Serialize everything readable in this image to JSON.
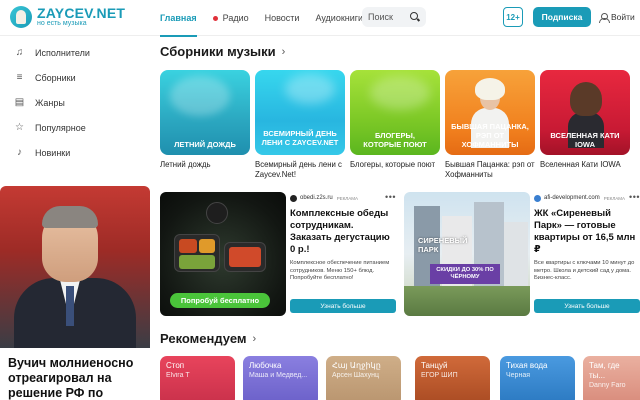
{
  "header": {
    "logo_title": "ZAYCEV.NET",
    "logo_sub": "но есть музыка",
    "nav": [
      {
        "label": "Главная",
        "active": true
      },
      {
        "label": "Радио",
        "live": true
      },
      {
        "label": "Новости"
      },
      {
        "label": "Аудиокниги"
      }
    ],
    "search_placeholder": "Поиск",
    "age_badge": "12+",
    "subscribe_label": "Подписка",
    "login_label": "Войти"
  },
  "sidebar": {
    "items": [
      {
        "label": "Исполнители",
        "icon": "artist-icon"
      },
      {
        "label": "Сборники",
        "icon": "list-icon"
      },
      {
        "label": "Жанры",
        "icon": "genres-icon"
      },
      {
        "label": "Популярное",
        "icon": "star-icon"
      },
      {
        "label": "Новинки",
        "icon": "note-icon"
      }
    ]
  },
  "news": {
    "title": "Вучич молниеносно отреагировал на решение РФ по"
  },
  "collections": {
    "title": "Сборники музыки",
    "items": [
      {
        "cover": "ЛЕТНИЙ ДОЖДЬ",
        "name": "Летний дождь",
        "color": "#2fb5c4"
      },
      {
        "cover": "ВСЕМИРНЫЙ ДЕНЬ ЛЕНИ С ZAYCEV.NET",
        "name": "Всемирный день лени с Zaycev.Net!",
        "color": "#27c0e0"
      },
      {
        "cover": "БЛОГЕРЫ, КОТОРЫЕ ПОЮТ",
        "name": "Блогеры, которые поют",
        "color": "#8ccf2b"
      },
      {
        "cover": "БЫВШАЯ ПАЦАНКА, РЭП ОТ ХОФМАННИТЫ",
        "name": "Бывшая Пацанка: рэп от Хофманниты",
        "color": "#f28a1e"
      },
      {
        "cover": "ВСЕЛЕННАЯ КАТИ IOWA",
        "name": "Вселенная Кати IOWA",
        "color": "#d01f3c"
      }
    ]
  },
  "ads": [
    {
      "domain": "obedi.z2s.ru",
      "mark": "РЕКЛАМА",
      "headline": "Комплексные обеды сотрудникам. Заказать дегустацию 0 р.!",
      "desc": "Комплексное обеспечение питанием сотрудников. Меню 150+ блюд. Попробуйте бесплатно!",
      "image_cta": "Попробуй бесплатно",
      "button": "Узнать больше"
    },
    {
      "domain": "afi-development.com",
      "mark": "РЕКЛАМА",
      "headline": "ЖК «Сиреневый Парк» — готовые квартиры от 16,5 млн ₽",
      "desc": "Все квартиры с ключами 10 минут до метро. Школа и детский сад у дома. Бизнес-класс.",
      "image_title": "СИРЕНЕВЫЙ ПАРК",
      "image_promo": "СКИДКИ ДО 30% ПО ЧЁРНОМУ",
      "button": "Узнать больше"
    }
  ],
  "recommendations": {
    "title": "Рекомендуем",
    "items": [
      {
        "title": "Стоп",
        "sub": "Elvira T",
        "color": "#e0405a"
      },
      {
        "title": "Любочка",
        "sub": "Маша и Медвед...",
        "color": "#7a6fd0"
      },
      {
        "title": "Հայ Աղջիկը",
        "sub": "Арсен Шахунц",
        "color": "#c3a07a"
      },
      {
        "title": "Танцуй",
        "sub": "ЕГОР ШИП",
        "color": "#c35a2e"
      },
      {
        "title": "Тихая вода",
        "sub": "Черная",
        "color": "#3a8ad0"
      },
      {
        "title": "Там, где ты...",
        "sub": "Danny Faro",
        "color": "#e0a090"
      }
    ]
  }
}
